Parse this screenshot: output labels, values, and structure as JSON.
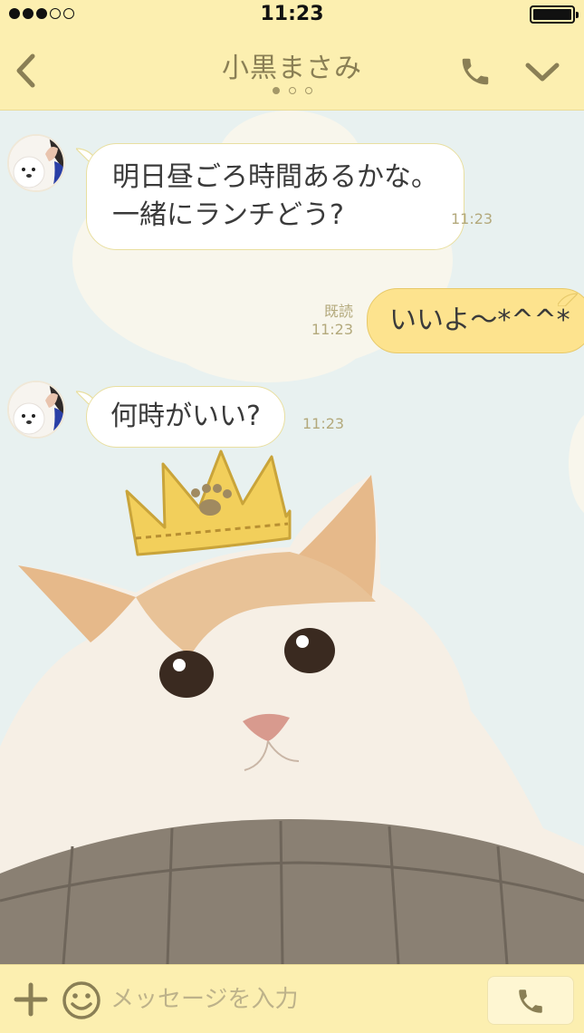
{
  "status_bar": {
    "time": "11:23",
    "signal_dots_filled": 3,
    "signal_dots_total": 5,
    "battery_level": 1.0
  },
  "header": {
    "back_icon": "chevron-left-icon",
    "title": "小黒まさみ",
    "page_indicator": {
      "count": 3,
      "active": 0
    },
    "call_icon": "phone-icon",
    "menu_icon": "chevron-down-icon"
  },
  "messages": [
    {
      "direction": "incoming",
      "lines": [
        "明日昼ごろ時間あるかな。",
        "一緒にランチどう?"
      ],
      "time": "11:23"
    },
    {
      "direction": "outgoing",
      "text": "いいよ〜*^^*",
      "read": "既読",
      "time": "11:23"
    },
    {
      "direction": "incoming",
      "text": "何時がいい?",
      "time": "11:23"
    }
  ],
  "sticker": {
    "type": "cat-with-crown-sticker"
  },
  "input_bar": {
    "plus_icon": "plus-icon",
    "emoji_icon": "smiley-icon",
    "placeholder": "メッセージを入力",
    "voice_icon": "phone-icon"
  },
  "colors": {
    "header_bg": "#fcefb0",
    "chat_bg": "#e8f1f0",
    "outgoing_bubble": "#fde38e",
    "incoming_bubble": "#ffffff",
    "meta_text": "#b3a97c"
  }
}
